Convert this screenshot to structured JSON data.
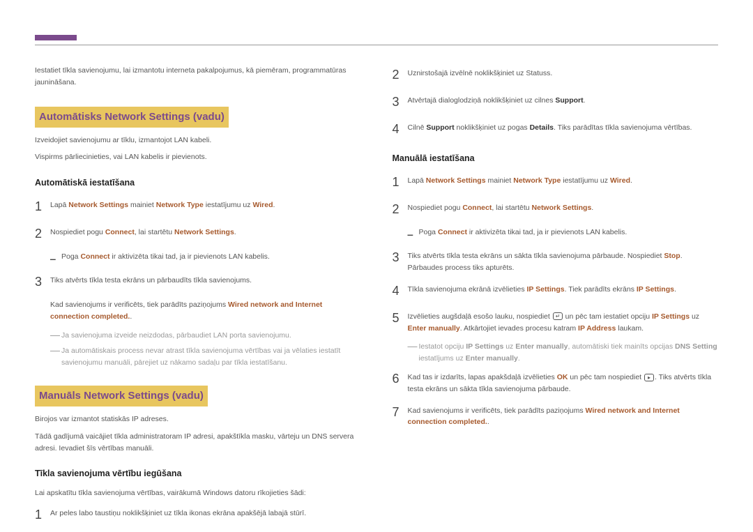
{
  "left": {
    "intro": "Iestatiet tīkla savienojumu, lai izmantotu interneta pakalpojumus, kā piemēram, programmatūras jaunināšana.",
    "section1_title": "Automātisks Network Settings (vadu)",
    "section1_p1": "Izveidojiet savienojumu ar tīklu, izmantojot LAN kabeli.",
    "section1_p2": "Vispirms pārliecinieties, vai LAN kabelis ir pievienots.",
    "auto_heading": "Automātiskā iestatīšana",
    "auto_step1_a": "Lapā ",
    "auto_step1_b": "Network Settings",
    "auto_step1_c": " mainiet ",
    "auto_step1_d": "Network Type",
    "auto_step1_e": " iestatījumu uz ",
    "auto_step1_f": "Wired",
    "auto_step2_a": "Nospiediet pogu ",
    "auto_step2_b": "Connect",
    "auto_step2_c": ", lai startētu ",
    "auto_step2_d": "Network Settings",
    "auto_sub1_a": "Poga ",
    "auto_sub1_b": "Connect",
    "auto_sub1_c": " ir aktivizēta tikai tad, ja ir pievienots LAN kabelis.",
    "auto_step3": "Tiks atvērts tīkla testa ekrāns un pārbaudīts tīkla savienojums.",
    "auto_step3_p_a": "Kad savienojums ir verificēts, tiek parādīts paziņojums ",
    "auto_step3_p_b": "Wired network and Internet connection completed.",
    "auto_note1": "Ja savienojuma izveide neizdodas, pārbaudiet LAN porta savienojumu.",
    "auto_note2": "Ja automātiskais process nevar atrast tīkla savienojuma vērtības vai ja vēlaties iestatīt savienojumu manuāli, pārejiet uz nākamo sadaļu par tīkla iestatīšanu.",
    "section2_title": "Manuāls Network Settings (vadu)",
    "section2_p1": "Birojos var izmantot statiskās IP adreses.",
    "section2_p2": "Tādā gadījumā vaicājiet tīkla administratoram IP adresi, apakštīkla masku, vārteju un DNS servera adresi. Ievadiet šīs vērtības manuāli.",
    "obtain_heading": "Tīkla savienojuma vērtību iegūšana",
    "obtain_p1": "Lai apskatītu tīkla savienojuma vērtības, vairākumā Windows datoru rīkojieties šādi:",
    "obtain_step1": "Ar peles labo taustiņu noklikšķiniet uz tīkla ikonas ekrāna apakšējā labajā stūrī."
  },
  "right": {
    "r_step2": "Uznirstošajā izvēlnē noklikšķiniet uz Statuss.",
    "r_step3_a": "Atvērtajā dialoglodziņā noklikšķiniet uz cilnes ",
    "r_step3_b": "Support",
    "r_step4_a": "Cilnē ",
    "r_step4_b": "Support",
    "r_step4_c": " noklikšķiniet uz pogas ",
    "r_step4_d": "Details",
    "r_step4_e": ". Tiks parādītas tīkla savienojuma vērtības.",
    "manual_heading": "Manuālā iestatīšana",
    "m_step1_a": "Lapā ",
    "m_step1_b": "Network Settings",
    "m_step1_c": " mainiet ",
    "m_step1_d": "Network Type",
    "m_step1_e": " iestatījumu uz ",
    "m_step1_f": "Wired",
    "m_step2_a": "Nospiediet pogu ",
    "m_step2_b": "Connect",
    "m_step2_c": ", lai startētu ",
    "m_step2_d": "Network Settings",
    "m_sub1_a": "Poga ",
    "m_sub1_b": "Connect",
    "m_sub1_c": " ir aktivizēta tikai tad, ja ir pievienots LAN kabelis.",
    "m_step3_a": "Tiks atvērts tīkla testa ekrāns un sākta tīkla savienojuma pārbaude. Nospiediet ",
    "m_step3_b": "Stop",
    "m_step3_c": ". Pārbaudes process tiks apturēts.",
    "m_step4_a": "Tīkla savienojuma ekrānā izvēlieties ",
    "m_step4_b": "IP Settings",
    "m_step4_c": ". Tiek parādīts ekrāns ",
    "m_step4_d": "IP Settings",
    "m_step5_a": "Izvēlieties augšdaļā esošo lauku, nospiediet ",
    "m_step5_b": " un pēc tam iestatiet opciju ",
    "m_step5_c": "IP Settings",
    "m_step5_d": " uz ",
    "m_step5_e": "Enter manually",
    "m_step5_f": ". Atkārtojiet ievades procesu katram ",
    "m_step5_g": "IP Address",
    "m_step5_h": " laukam.",
    "m_note_a": "Iestatot opciju ",
    "m_note_b": "IP Settings",
    "m_note_c": " uz ",
    "m_note_d": "Enter manually",
    "m_note_e": ", automātiski tiek mainīts opcijas ",
    "m_note_f": "DNS Setting",
    "m_note_g": " iestatījums uz ",
    "m_note_h": "Enter manually",
    "m_step6_a": "Kad tas ir izdarīts, lapas apakšdaļā izvēlieties ",
    "m_step6_b": "OK",
    "m_step6_c": " un pēc tam nospiediet ",
    "m_step6_d": ". Tiks atvērts tīkla testa ekrāns un sākta tīkla savienojuma pārbaude.",
    "m_step7_a": "Kad savienojums ir verificēts, tiek parādīts paziņojums ",
    "m_step7_b": "Wired network and Internet connection completed."
  }
}
